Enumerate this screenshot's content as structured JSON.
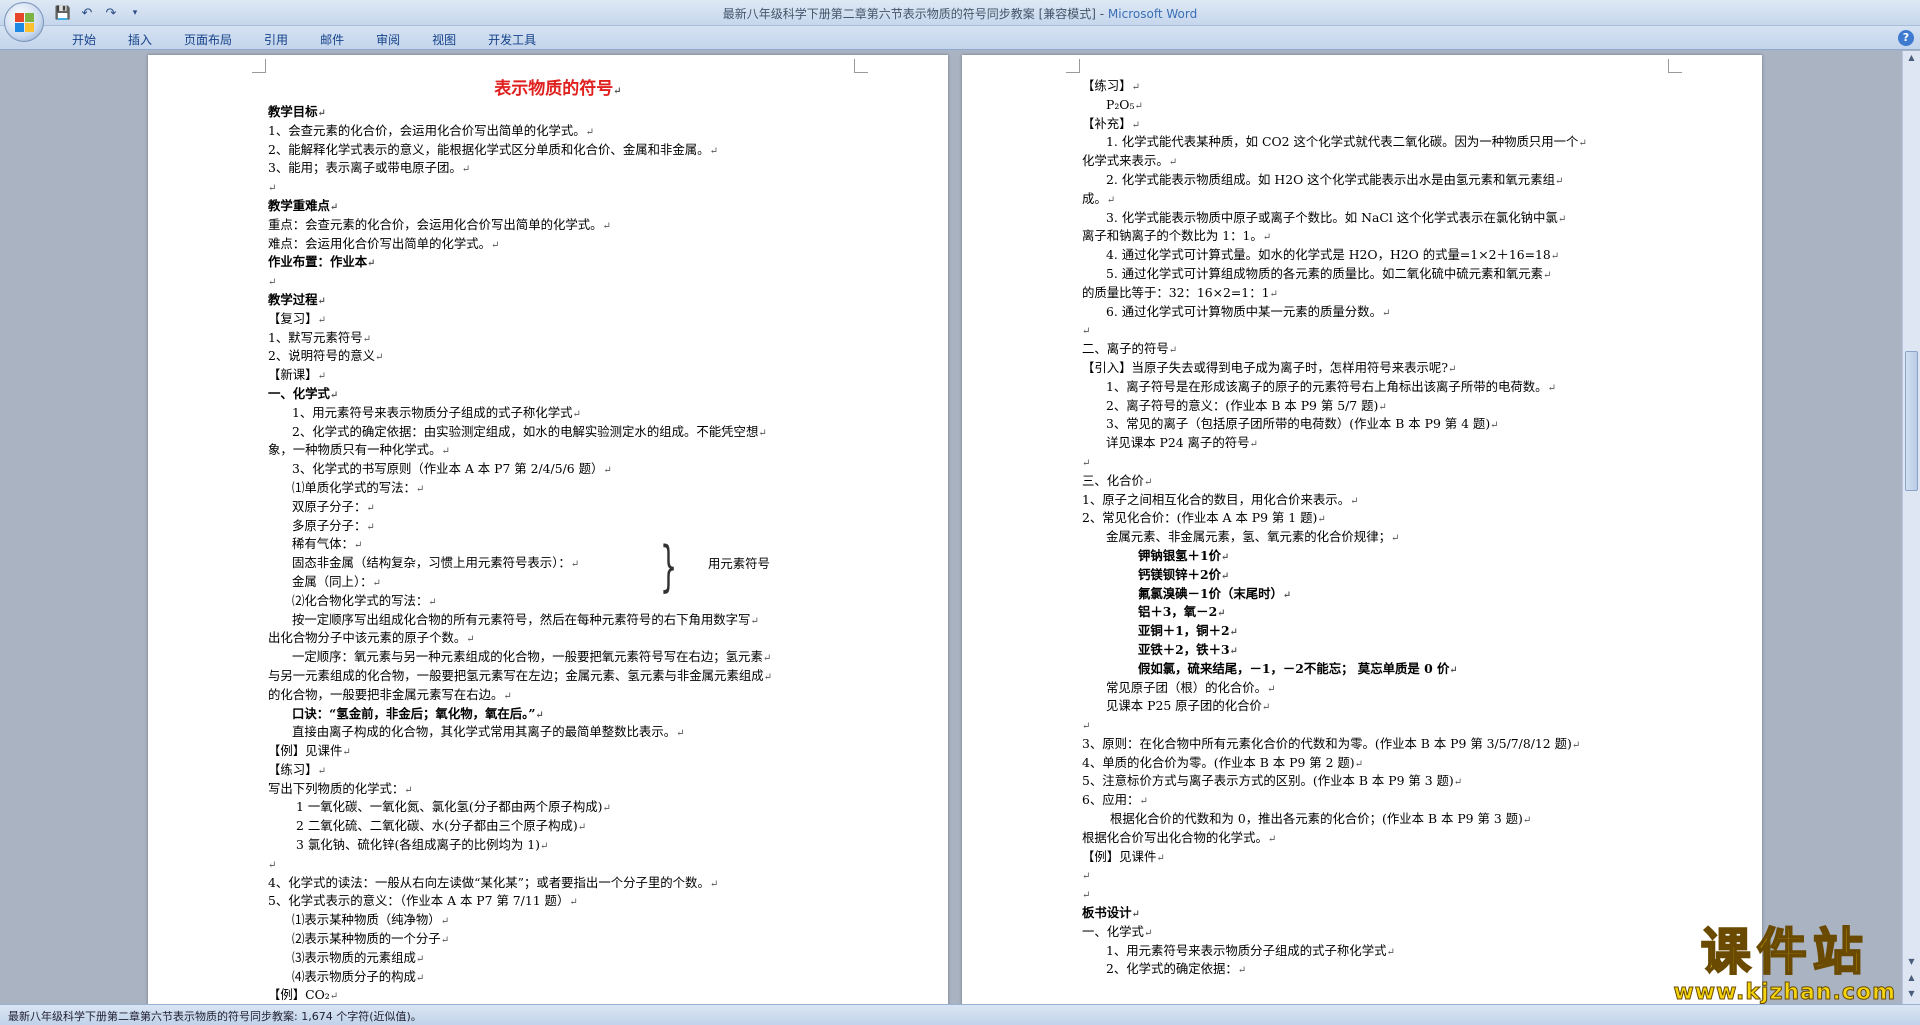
{
  "window": {
    "title_doc": "最新八年级科学下册第二章第六节表示物质的符号同步教案 [兼容模式] - ",
    "title_app": "Microsoft Word"
  },
  "ribbon": {
    "tabs": [
      "开始",
      "插入",
      "页面布局",
      "引用",
      "邮件",
      "审阅",
      "视图",
      "开发工具"
    ]
  },
  "left_page": [
    {
      "t": "教学目标",
      "c": "bold"
    },
    {
      "t": "1、会查元素的化合价，会运用化合价写出简单的化学式。"
    },
    {
      "t": "2、能解释化学式表示的意义，能根据化学式区分单质和化合价、金属和非金属。"
    },
    {
      "t": "3、能用；表示离子或带电原子团。"
    },
    {
      "t": ""
    },
    {
      "t": "教学重难点",
      "c": "bold"
    },
    {
      "t": "重点：会查元素的化合价，会运用化合价写出简单的化学式。"
    },
    {
      "t": "难点：会运用化合价写出简单的化学式。"
    },
    {
      "t": "作业布置：作业本",
      "c": "bold"
    },
    {
      "t": ""
    },
    {
      "t": "教学过程",
      "c": "bold"
    },
    {
      "t": "【复习】"
    },
    {
      "t": "1、默写元素符号"
    },
    {
      "t": "2、说明符号的意义"
    },
    {
      "t": "【新课】"
    },
    {
      "t": "一、化学式",
      "c": "bold"
    },
    {
      "t": "1、用元素符号来表示物质分子组成的式子称化学式",
      "c": "indent1"
    },
    {
      "t": "2、化学式的确定依据：由实验测定组成，如水的电解实验测定水的组成。不能凭空想",
      "c": "indent1"
    },
    {
      "t": "象，一种物质只有一种化学式。"
    },
    {
      "t": "3、化学式的书写原则（作业本 A 本 P7 第 2/4/5/6 题）",
      "c": "indent1"
    },
    {
      "t": "⑴单质化学式的写法：",
      "c": "indent1"
    },
    {
      "t": "双原子分子：",
      "c": "indent1"
    },
    {
      "t": "多原子分子：",
      "c": "indent1"
    },
    {
      "t": "稀有气体：",
      "c": "indent1"
    },
    {
      "t": "固态非金属（结构复杂，习惯上用元素符号表示）：",
      "c": "indent1"
    },
    {
      "t": "金属（同上）：",
      "c": "indent1"
    },
    {
      "t": "⑵化合物化学式的写法：",
      "c": "indent1"
    },
    {
      "t": "按一定顺序写出组成化合物的所有元素符号，然后在每种元素符号的右下角用数字写",
      "c": "indent1"
    },
    {
      "t": "出化合物分子中该元素的原子个数。"
    },
    {
      "t": "一定顺序：氧元素与另一种元素组成的化合物，一般要把氧元素符号写在右边；氢元素",
      "c": "indent1"
    },
    {
      "t": "与另一元素组成的化合物，一般要把氢元素写在左边；金属元素、氢元素与非金属元素组成"
    },
    {
      "t": "的化合物，一般要把非金属元素写在右边。"
    },
    {
      "t": "口诀：“氢金前，非金后；氧化物，氧在后。”",
      "c": "indent1 bold"
    },
    {
      "t": "直接由离子构成的化合物，其化学式常用其离子的最简单整数比表示。",
      "c": "indent1"
    },
    {
      "t": "【例】见课件"
    },
    {
      "t": "【练习】"
    },
    {
      "t": "写出下列物质的化学式："
    },
    {
      "t": "1 一氧化碳、一氧化氮、氯化氢(分子都由两个原子构成)",
      "c": "indent2"
    },
    {
      "t": "2 二氧化硫、二氧化碳、水(分子都由三个原子构成)",
      "c": "indent2"
    },
    {
      "t": "3  氯化钠、硫化锌(各组成离子的比例均为 1)",
      "c": "indent2"
    },
    {
      "t": ""
    },
    {
      "t": "4、化学式的读法：一般从右向左读做“某化某”；或者要指出一个分子里的个数。"
    },
    {
      "t": "5、化学式表示的意义：（作业本 A 本 P7 第 7/11 题）"
    },
    {
      "t": "⑴表示某种物质（纯净物）",
      "c": "indent1"
    },
    {
      "t": "⑵表示某种物质的一个分子",
      "c": "indent1"
    },
    {
      "t": "⑶表示物质的元素组成",
      "c": "indent1"
    },
    {
      "t": "⑷表示物质分子的构成",
      "c": "indent1"
    },
    {
      "t": "【例】CO₂"
    }
  ],
  "left_title": "表示物质的符号",
  "brace_label": "用元素符号",
  "right_page": [
    {
      "t": "【练习】"
    },
    {
      "t": "P₂O₅",
      "c": "indent1"
    },
    {
      "t": "【补充】"
    },
    {
      "t": "1. 化学式能代表某种质，如 CO2 这个化学式就代表二氧化碳。因为一种物质只用一个",
      "c": "indent1"
    },
    {
      "t": "化学式来表示。"
    },
    {
      "t": "    2. 化学式能表示物质组成。如 H2O 这个化学式能表示出水是由氢元素和氧元素组",
      "c": "indent1"
    },
    {
      "t": "成。"
    },
    {
      "t": "    3. 化学式能表示物质中原子或离子个数比。如 NaCl 这个化学式表示在氯化钠中氯",
      "c": "indent1"
    },
    {
      "t": "离子和钠离子的个数比为 1：1。"
    },
    {
      "t": "    4. 通过化学式可计算式量。如水的化学式是 H2O，H2O 的式量=1×2＋16=18",
      "c": "indent1"
    },
    {
      "t": "    5. 通过化学式可计算组成物质的各元素的质量比。如二氧化硫中硫元素和氧元素",
      "c": "indent1"
    },
    {
      "t": "的质量比等于：32：16×2=1：1"
    },
    {
      "t": "  6. 通过化学式可计算物质中某一元素的质量分数。",
      "c": "indent1"
    },
    {
      "t": ""
    },
    {
      "t": "二、离子的符号"
    },
    {
      "t": "【引入】当原子失去或得到电子成为离子时，怎样用符号来表示呢?"
    },
    {
      "t": "1、离子符号是在形成该离子的原子的元素符号右上角标出该离子所带的电荷数。",
      "c": "indent1"
    },
    {
      "t": "2、离子符号的意义：(作业本 B 本 P9 第 5/7 题)",
      "c": "indent1"
    },
    {
      "t": "3、常见的离子（包括原子团所带的电荷数）(作业本 B 本 P9 第 4 题)",
      "c": "indent1"
    },
    {
      "t": "详见课本 P24  离子的符号",
      "c": "indent1"
    },
    {
      "t": ""
    },
    {
      "t": "三、化合价"
    },
    {
      "t": "1、原子之间相互化合的数目，用化合价来表示。"
    },
    {
      "t": "2、常见化合价：(作业本 A 本 P9 第 1 题)"
    },
    {
      "t": "金属元素、非金属元素，氢、氧元素的化合价规律；",
      "c": "indent1"
    },
    {
      "t": "钾钠银氢＋1价",
      "c": "bold",
      "p": 56
    },
    {
      "t": "钙镁钡锌＋2价",
      "c": "bold",
      "p": 56
    },
    {
      "t": "氟氯溴碘－1价（末尾时）",
      "c": "bold",
      "p": 56
    },
    {
      "t": "铝＋3，氧－2",
      "c": "bold",
      "p": 56
    },
    {
      "t": "亚铜＋1，铜＋2",
      "c": "bold",
      "p": 56
    },
    {
      "t": "亚铁＋2，铁＋3",
      "c": "bold",
      "p": 56
    },
    {
      "t": "假如氯，硫来结尾，－1，－2不能忘；     莫忘单质是 0 价",
      "c": "bold",
      "p": 56
    },
    {
      "t": "常见原子团（根）的化合价。",
      "c": "indent1"
    },
    {
      "t": "见课本 P25     原子团的化合价",
      "c": "indent1"
    },
    {
      "t": ""
    },
    {
      "t": "3、原则：在化合物中所有元素化合价的代数和为零。(作业本 B 本 P9 第 3/5/7/8/12 题)"
    },
    {
      "t": "4、单质的化合价为零。(作业本 B 本 P9 第 2 题)"
    },
    {
      "t": "5、注意标价方式与离子表示方式的区别。(作业本 B 本 P9 第 3 题)"
    },
    {
      "t": "6、应用："
    },
    {
      "t": "根据化合价的代数和为 0，推出各元素的化合价；(作业本 B 本 P9 第 3 题)",
      "c": "indent2"
    },
    {
      "t": "根据化合价写出化合物的化学式。"
    },
    {
      "t": "【例】见课件"
    },
    {
      "t": ""
    },
    {
      "t": ""
    },
    {
      "t": "板书设计",
      "c": "bold"
    },
    {
      "t": "一、化学式"
    },
    {
      "t": "1、用元素符号来表示物质分子组成的式子称化学式",
      "c": "indent1"
    },
    {
      "t": "2、化学式的确定依据：",
      "c": "indent1"
    }
  ],
  "status": {
    "text": "最新八年级科学下册第二章第六节表示物质的符号同步教案: 1,674 个字符(近似值)。"
  },
  "watermark": {
    "title": "课件站",
    "url": "www.kjzhan.com"
  },
  "colors": {
    "title_red": "#e0201e",
    "watermark_yellow": "#f5d50e",
    "ribbon_text": "#15428b"
  }
}
